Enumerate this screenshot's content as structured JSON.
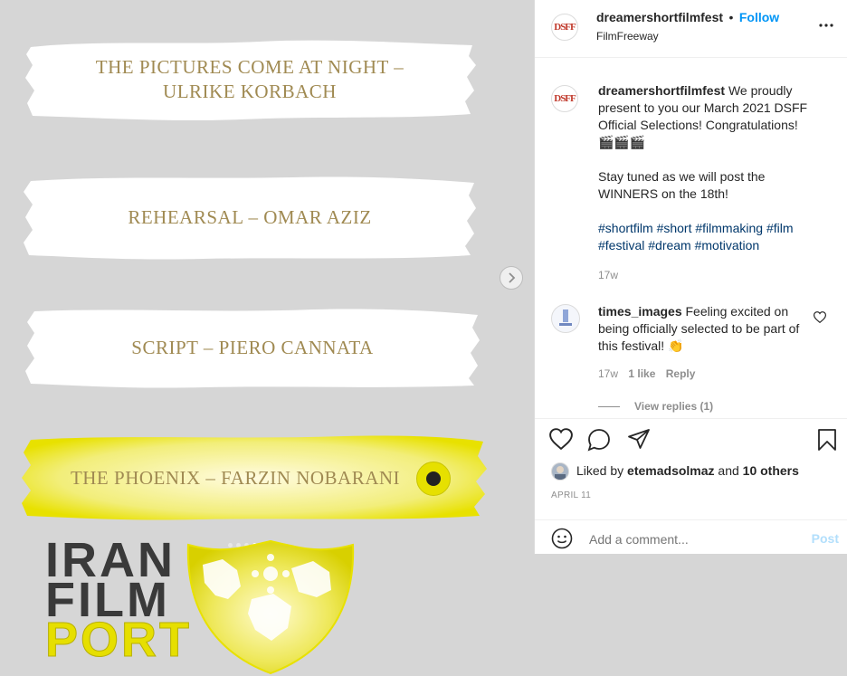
{
  "post": {
    "slides": [
      {
        "line1": "THE PICTURES COME AT NIGHT –",
        "line2": "ULRIKE KORBACH"
      },
      {
        "line1": "REHEARSAL – OMAR AZIZ"
      },
      {
        "line1": "SCRIPT – PIERO CANNATA"
      },
      {
        "line1": "THE PHOENIX – FARZIN NOBARANI"
      }
    ],
    "logo": {
      "line1": "IRAN",
      "line2": "FILM",
      "line3": "PORT"
    },
    "carousel_next_icon": "chevron-right-icon"
  },
  "header": {
    "avatar_text": "DSFF",
    "username": "dreamershortfilmfest",
    "separator": "•",
    "follow_label": "Follow",
    "location": "FilmFreeway",
    "more_icon": "more-horizontal-icon"
  },
  "caption": {
    "username": "dreamershortfilmfest",
    "text": "We proudly present to you our March 2021 DSFF Official Selections! Congratulations!",
    "emojis": "🎬🎬🎬",
    "paragraph2": "Stay tuned as we will post the WINNERS on the 18th!",
    "hashtags_line1": "#shortfilm #short #filmmaking #film",
    "hashtags_line2": "#festival #dream #motivation",
    "time": "17w"
  },
  "comment": {
    "username": "times_images",
    "text": "Feeling excited on being officially selected to be part of this festival! 👏",
    "time": "17w",
    "likes": "1 like",
    "reply": "Reply",
    "view_replies": "View replies (1)"
  },
  "actions": {
    "liked_by_prefix": "Liked by",
    "liked_by_user": "etemadsolmaz",
    "and_text": "and",
    "others": "10 others",
    "date": "APRIL 11"
  },
  "add_comment": {
    "placeholder": "Add a comment...",
    "post_label": "Post"
  },
  "colors": {
    "accent_blue": "#0095f6",
    "gold_text": "#a08a52",
    "highlight_yellow": "#e8e100"
  }
}
